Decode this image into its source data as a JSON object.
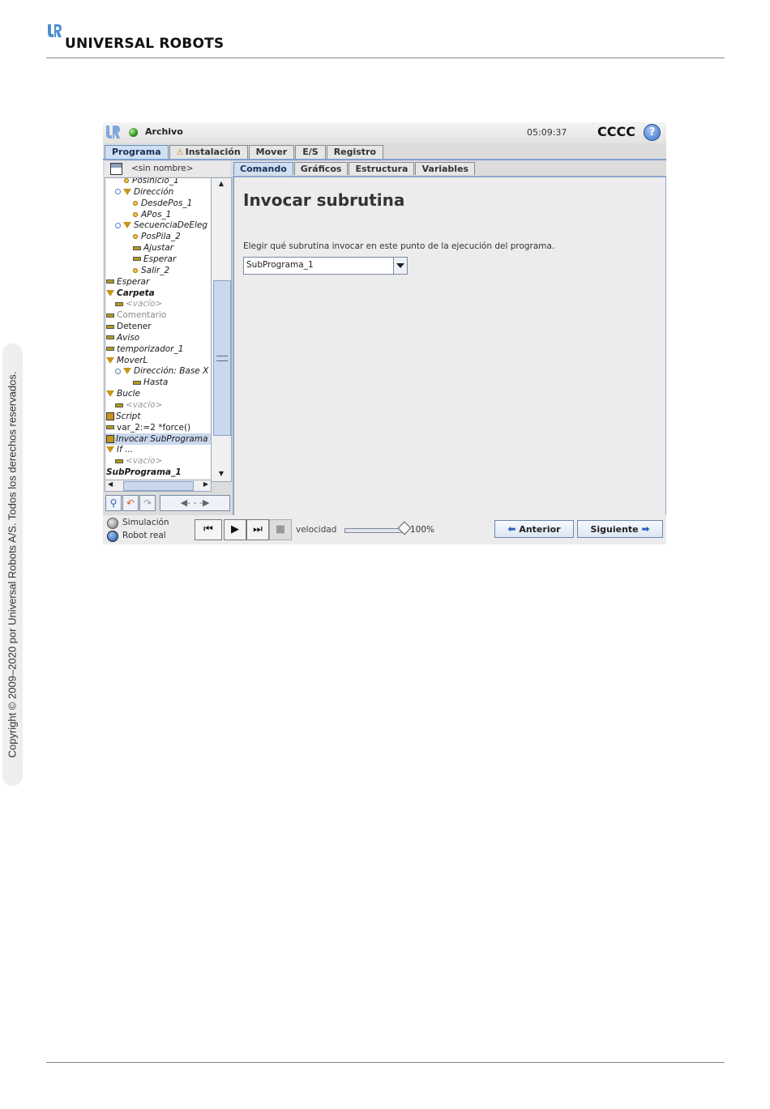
{
  "document": {
    "brand": "UNIVERSAL ROBOTS",
    "copyright": "Copyright © 2009–2020 por Universal Robots A/S. Todos los derechos reservados."
  },
  "topbar": {
    "file_label": "Archivo",
    "clock": "05:09:37",
    "robot_name": "CCCC",
    "help_label": "?"
  },
  "main_tabs": [
    {
      "label": "Programa",
      "active": true
    },
    {
      "label": "Instalación",
      "warning": true
    },
    {
      "label": "Mover"
    },
    {
      "label": "E/S"
    },
    {
      "label": "Registro"
    }
  ],
  "program": {
    "name": "<sin nombre>"
  },
  "tree": [
    {
      "label": "Posinicio_1",
      "indent": 2,
      "marker": "dot",
      "style": "it"
    },
    {
      "label": "Dirección",
      "indent": 1,
      "marker": "tri",
      "style": "it",
      "collapse": true
    },
    {
      "label": "DesdePos_1",
      "indent": 3,
      "marker": "dot",
      "style": "it"
    },
    {
      "label": "APos_1",
      "indent": 3,
      "marker": "dot",
      "style": "it"
    },
    {
      "label": "SecuenciaDeEleg",
      "indent": 1,
      "marker": "tri",
      "style": "it",
      "collapse": true
    },
    {
      "label": "PosPila_2",
      "indent": 3,
      "marker": "dot",
      "style": "it"
    },
    {
      "label": "Ajustar",
      "indent": 3,
      "marker": "bar",
      "style": "it"
    },
    {
      "label": "Esperar",
      "indent": 3,
      "marker": "bar",
      "style": "it"
    },
    {
      "label": "Salir_2",
      "indent": 3,
      "marker": "dot",
      "style": "it"
    },
    {
      "label": "Esperar",
      "indent": 0,
      "marker": "bar",
      "style": "it"
    },
    {
      "label": "Carpeta",
      "indent": 0,
      "marker": "tri",
      "style": "bold it"
    },
    {
      "label": "<vacío>",
      "indent": 1,
      "marker": "bar",
      "style": "grey"
    },
    {
      "label": "Comentario",
      "indent": 0,
      "marker": "bar",
      "style": "grey-normal"
    },
    {
      "label": "Detener",
      "indent": 0,
      "marker": "bar",
      "style": ""
    },
    {
      "label": "Aviso",
      "indent": 0,
      "marker": "bar",
      "style": "it"
    },
    {
      "label": "temporizador_1",
      "indent": 0,
      "marker": "bar",
      "style": "it"
    },
    {
      "label": "MoverL",
      "indent": 0,
      "marker": "tri",
      "style": "it"
    },
    {
      "label": "Dirección: Base X",
      "indent": 1,
      "marker": "tri",
      "style": "it",
      "collapse": true
    },
    {
      "label": "Hasta",
      "indent": 3,
      "marker": "bar",
      "style": "it"
    },
    {
      "label": "Bucle",
      "indent": 0,
      "marker": "tri",
      "style": "it"
    },
    {
      "label": "<vacío>",
      "indent": 1,
      "marker": "bar",
      "style": "grey"
    },
    {
      "label": "Script",
      "indent": 0,
      "marker": "box",
      "style": "it"
    },
    {
      "label": "var_2:=2 *force()",
      "indent": 0,
      "marker": "bar",
      "style": ""
    },
    {
      "label": "Invocar SubPrograma",
      "indent": 0,
      "marker": "box",
      "style": "it",
      "selected": true
    },
    {
      "label": "If ...",
      "indent": 0,
      "marker": "tri",
      "style": "it"
    },
    {
      "label": "<vacío>",
      "indent": 1,
      "marker": "bar",
      "style": "grey"
    },
    {
      "label": "SubPrograma_1",
      "indent": 0,
      "marker": "none",
      "style": "bold it"
    }
  ],
  "command_tabs": [
    {
      "label": "Comando",
      "active": true
    },
    {
      "label": "Gráficos"
    },
    {
      "label": "Estructura"
    },
    {
      "label": "Variables"
    }
  ],
  "command": {
    "title": "Invocar subrutina",
    "instruction": "Elegir qué subrutina invocar en este punto de la ejecución del programa.",
    "subroutine_selected": "SubPrograma_1"
  },
  "bottom": {
    "mode_simulation": "Simulación",
    "mode_real": "Robot real",
    "speed_label": "velocidad",
    "speed_value": "100%",
    "speed_fraction": 1.0,
    "prev_label": "Anterior",
    "next_label": "Siguiente"
  }
}
